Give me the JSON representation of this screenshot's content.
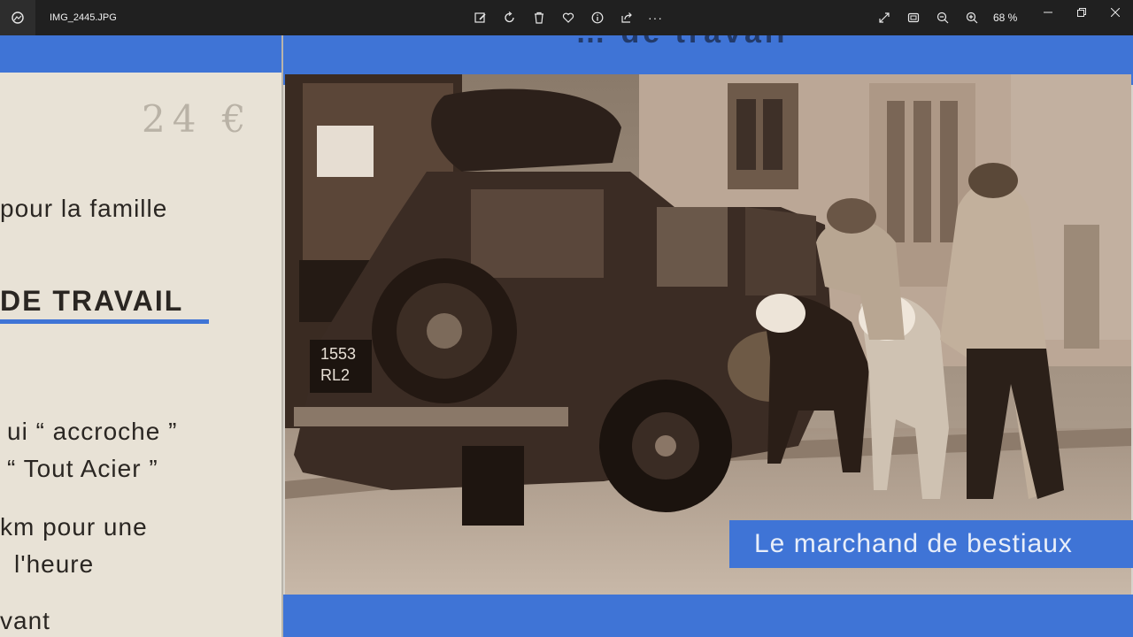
{
  "window": {
    "filename": "IMG_2445.JPG",
    "zoom": "68 %",
    "icons": {
      "app": "photos-app-icon",
      "toolbar": [
        "edit-image-icon",
        "rotate-icon",
        "delete-icon",
        "favorite-icon",
        "info-icon",
        "share-icon",
        "more-icon"
      ],
      "right": [
        "fullscreen-icon",
        "fit-window-icon",
        "zoom-out-icon",
        "zoom-in-icon"
      ],
      "window_controls": [
        "minimize-icon",
        "maximize-icon",
        "close-icon"
      ]
    },
    "toolbar_more": "···"
  },
  "left_page": {
    "handwriting": "24 €",
    "line1": "pour  la  famille",
    "heading": "DE  TRAVAIL",
    "line2": "ui  “ accroche ”",
    "line3": "“ Tout  Acier ”",
    "line4": "km   pour   une",
    "line5": "l'heure",
    "line6": "vant",
    "accent_color": "#3f74d6"
  },
  "right_page": {
    "band_text": "… de travail",
    "caption": "Le marchand de bestiaux",
    "plate_line1": "1553",
    "plate_line2": "RL2",
    "band_color": "#3f74d6"
  }
}
